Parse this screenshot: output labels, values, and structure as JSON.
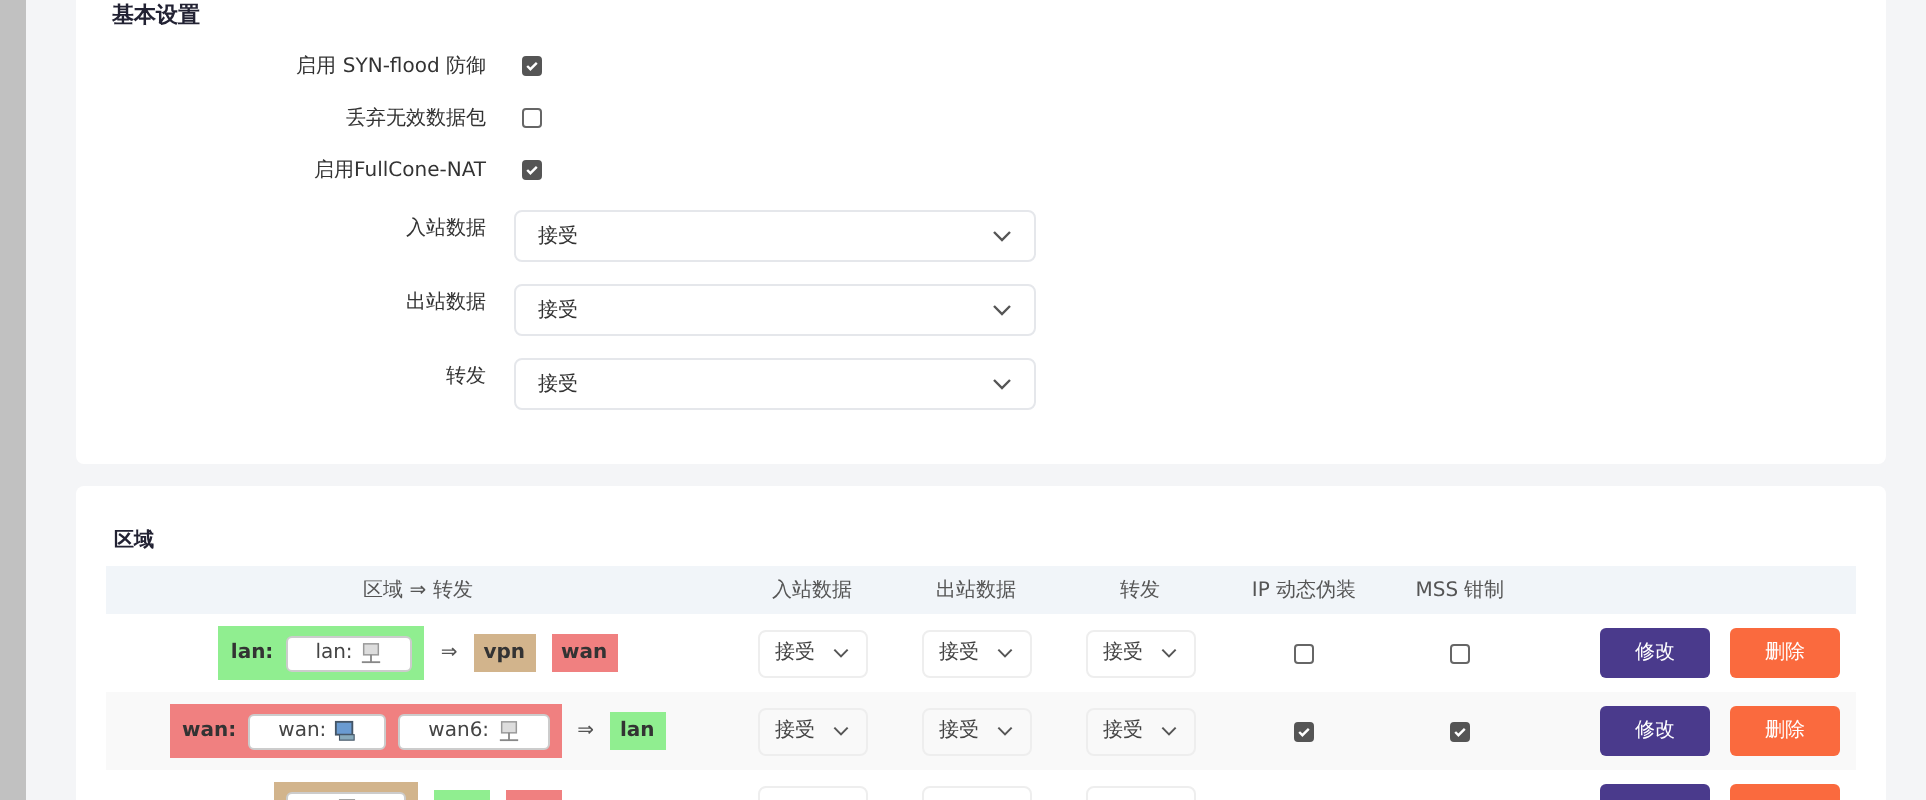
{
  "basic_settings": {
    "title": "基本设置",
    "fields": [
      {
        "kind": "checkbox",
        "label": "启用 SYN-flood 防御",
        "checked": true
      },
      {
        "kind": "checkbox",
        "label": "丢弃无效数据包",
        "checked": false
      },
      {
        "kind": "checkbox",
        "label": "启用FullCone-NAT",
        "checked": true
      },
      {
        "kind": "select",
        "label": "入站数据",
        "value": "接受"
      },
      {
        "kind": "select",
        "label": "出站数据",
        "value": "接受"
      },
      {
        "kind": "select",
        "label": "转发",
        "value": "接受"
      }
    ]
  },
  "zones": {
    "title": "区域",
    "columns": [
      "区域 ⇒ 转发",
      "入站数据",
      "出站数据",
      "转发",
      "IP 动态伪装",
      "MSS 钳制"
    ],
    "rows": [
      {
        "name": "lan:",
        "color": "#90ee90",
        "networks": [
          {
            "label": "lan:",
            "kind": "plain"
          }
        ],
        "arrow": "⇒",
        "forwards": [
          {
            "label": "vpn",
            "color": "#d2b48c"
          },
          {
            "label": "wan",
            "color": "#f08080"
          }
        ],
        "input": "接受",
        "output": "接受",
        "forward": "接受",
        "masq": false,
        "mss": false,
        "actions": [
          "修改",
          "删除"
        ]
      },
      {
        "name": "wan:",
        "color": "#f08080",
        "networks": [
          {
            "label": "wan:",
            "kind": "colored"
          },
          {
            "label": "wan6:",
            "kind": "plain"
          }
        ],
        "arrow": "⇒",
        "forwards": [
          {
            "label": "lan",
            "color": "#90ee90"
          }
        ],
        "input": "接受",
        "output": "接受",
        "forward": "接受",
        "masq": true,
        "mss": true,
        "actions": [
          "修改",
          "删除"
        ]
      },
      {
        "color": "#d2b48c",
        "networks": [
          {
            "kind": "plain"
          }
        ],
        "forwards": [
          {
            "color": "#90ee90"
          },
          {
            "color": "#f08080"
          }
        ]
      }
    ]
  }
}
